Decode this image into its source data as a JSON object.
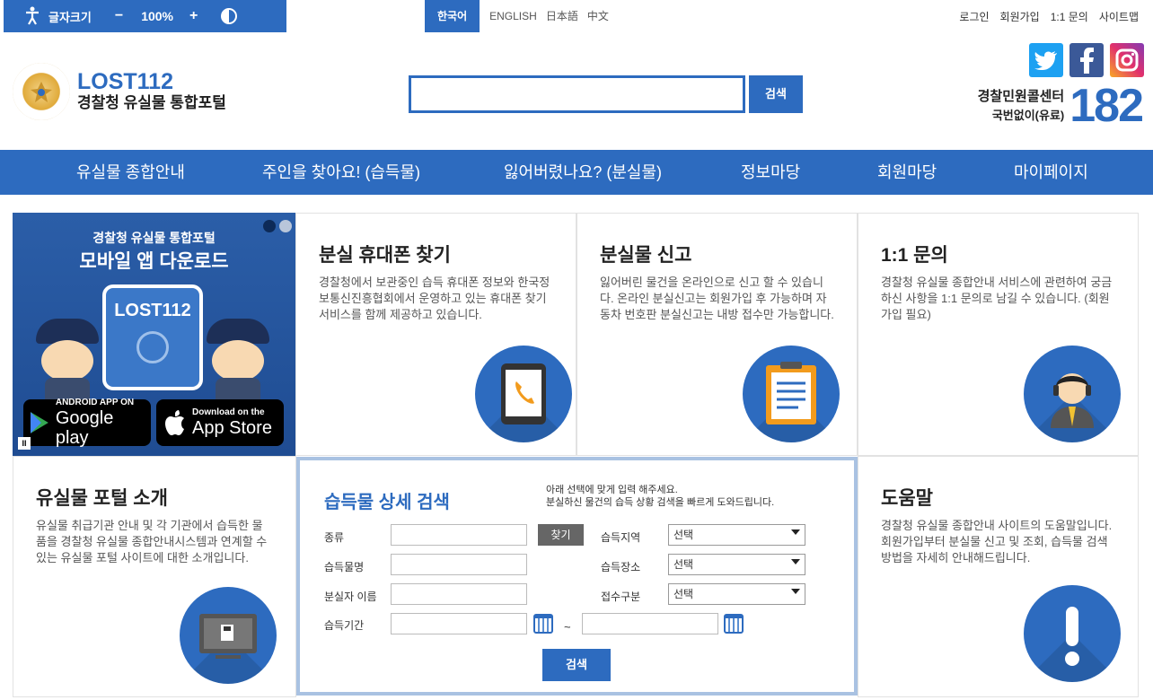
{
  "topbar": {
    "font_label": "글자크기",
    "minus": "−",
    "zoom": "100%",
    "plus": "+",
    "languages": [
      "한국어",
      "ENGLISH",
      "日本語",
      "中文"
    ],
    "util_links": [
      "로그인",
      "회원가입",
      "1:1 문의",
      "사이트맵"
    ]
  },
  "header": {
    "logo_title": "LOST112",
    "logo_subtitle": "경찰청 유실물 통합포털",
    "search_button": "검색",
    "call_center_title": "경찰민원콜센터",
    "call_center_sub": "국번없이(유료)",
    "call_center_number": "182",
    "social": [
      "twitter-icon",
      "facebook-icon",
      "instagram-icon"
    ]
  },
  "nav": {
    "items": [
      "유실물 종합안내",
      "주인을 찾아요! (습득물)",
      "잃어버렸나요? (분실물)",
      "정보마당",
      "회원마당",
      "마이페이지"
    ]
  },
  "banner": {
    "line1": "경찰청 유실물 통합포털",
    "line2": "모바일 앱 다운로드",
    "app_title": "LOST112",
    "google_small": "ANDROID APP ON",
    "google_big": "Google play",
    "apple_small": "Download on the",
    "apple_big": "App Store",
    "pause": "II"
  },
  "cards": {
    "phone": {
      "title": "분실 휴대폰 찾기",
      "text": "경찰청에서 보관중인 습득 휴대폰 정보와 한국정보통신진흥협회에서 운영하고 있는 휴대폰 찾기 서비스를 함께 제공하고 있습니다."
    },
    "report": {
      "title": "분실물 신고",
      "text": "잃어버린 물건을 온라인으로 신고 할 수 있습니다. 온라인 분실신고는 회원가입 후 가능하며 자동차 번호판 분실신고는 내방 접수만 가능합니다."
    },
    "inquiry": {
      "title": "1:1 문의",
      "text": "경찰청 유실물 종합안내 서비스에 관련하여 궁금하신 사항을 1:1 문의로 남길 수 있습니다. (회원가입 필요)"
    },
    "intro": {
      "title": "유실물 포털 소개",
      "text": "유실물 취급기관 안내 및 각 기관에서 습득한 물품을 경찰청 유실물 종합안내시스템과 연계할 수 있는 유실물 포털 사이트에 대한 소개입니다."
    },
    "help": {
      "title": "도움말",
      "text": "경찰청 유실물 종합안내 사이트의 도움말입니다. 회원가입부터 분실물 신고 및 조회, 습득물 검색 방법을 자세히 안내해드립니다."
    }
  },
  "search_form": {
    "title": "습득물 상세 검색",
    "note_line1": "아래 선택에 맞게 입력 해주세요.",
    "note_line2": "분실하신 물건의 습득 상황 검색을 빠르게 도와드립니다.",
    "labels": {
      "type": "종류",
      "name": "습득물명",
      "owner": "분실자 이름",
      "period": "습득기간",
      "region": "습득지역",
      "place": "습득장소",
      "receipt": "접수구분"
    },
    "find_button": "찾기",
    "select_default": "선택",
    "tilde": "~",
    "search_button": "검색"
  }
}
